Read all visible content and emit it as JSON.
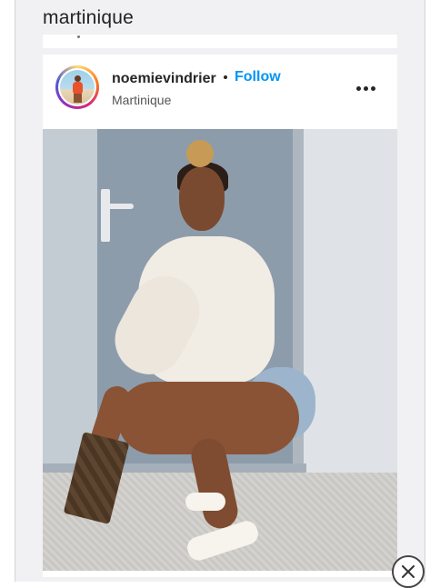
{
  "search": {
    "term": "martinique"
  },
  "post": {
    "username": "noemievindrier",
    "follow_label": "Follow",
    "location": "Martinique",
    "avatar_icon": "profile-avatar",
    "more_icon": "more-options-icon",
    "image_alt": "Woman in white blouse and denim shorts squatting beside a door holding a patterned clutch"
  },
  "colors": {
    "follow_blue": "#0095f6",
    "text_dark": "#262626",
    "page_bg": "#f1f1f3"
  },
  "overlay": {
    "close_icon": "close-icon"
  }
}
